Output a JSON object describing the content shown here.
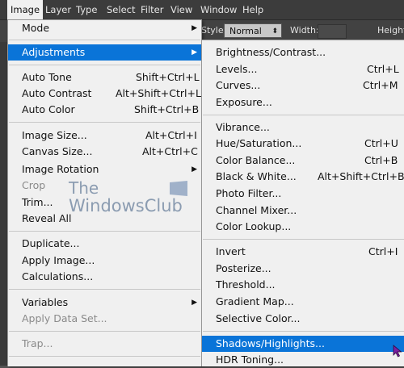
{
  "menubar": {
    "items": [
      "Image",
      "Layer",
      "Type",
      "Select",
      "Filter",
      "View",
      "Window",
      "Help"
    ]
  },
  "options_bar": {
    "style_label": "Style:",
    "style_value": "Normal",
    "width_label": "Width:",
    "height_label": "Height:"
  },
  "image_menu": {
    "items": [
      {
        "label": "Mode",
        "shortcut": "",
        "submenu": true
      },
      {
        "label": "Adjustments",
        "shortcut": "",
        "submenu": true,
        "highlighted": true
      },
      {
        "label": "Auto Tone",
        "shortcut": "Shift+Ctrl+L"
      },
      {
        "label": "Auto Contrast",
        "shortcut": "Alt+Shift+Ctrl+L"
      },
      {
        "label": "Auto Color",
        "shortcut": "Shift+Ctrl+B"
      },
      {
        "label": "Image Size...",
        "shortcut": "Alt+Ctrl+I"
      },
      {
        "label": "Canvas Size...",
        "shortcut": "Alt+Ctrl+C"
      },
      {
        "label": "Image Rotation",
        "shortcut": "",
        "submenu": true
      },
      {
        "label": "Crop",
        "shortcut": "",
        "disabled": true
      },
      {
        "label": "Trim...",
        "shortcut": ""
      },
      {
        "label": "Reveal All",
        "shortcut": ""
      },
      {
        "label": "Duplicate...",
        "shortcut": ""
      },
      {
        "label": "Apply Image...",
        "shortcut": ""
      },
      {
        "label": "Calculations...",
        "shortcut": ""
      },
      {
        "label": "Variables",
        "shortcut": "",
        "submenu": true
      },
      {
        "label": "Apply Data Set...",
        "shortcut": "",
        "disabled": true
      },
      {
        "label": "Trap...",
        "shortcut": "",
        "disabled": true
      }
    ]
  },
  "adjustments_menu": {
    "items": [
      {
        "label": "Brightness/Contrast...",
        "shortcut": ""
      },
      {
        "label": "Levels...",
        "shortcut": "Ctrl+L"
      },
      {
        "label": "Curves...",
        "shortcut": "Ctrl+M"
      },
      {
        "label": "Exposure...",
        "shortcut": ""
      },
      {
        "label": "Vibrance...",
        "shortcut": ""
      },
      {
        "label": "Hue/Saturation...",
        "shortcut": "Ctrl+U"
      },
      {
        "label": "Color Balance...",
        "shortcut": "Ctrl+B"
      },
      {
        "label": "Black & White...",
        "shortcut": "Alt+Shift+Ctrl+B"
      },
      {
        "label": "Photo Filter...",
        "shortcut": ""
      },
      {
        "label": "Channel Mixer...",
        "shortcut": ""
      },
      {
        "label": "Color Lookup...",
        "shortcut": ""
      },
      {
        "label": "Invert",
        "shortcut": "Ctrl+I"
      },
      {
        "label": "Posterize...",
        "shortcut": ""
      },
      {
        "label": "Threshold...",
        "shortcut": ""
      },
      {
        "label": "Gradient Map...",
        "shortcut": ""
      },
      {
        "label": "Selective Color...",
        "shortcut": ""
      },
      {
        "label": "Shadows/Highlights...",
        "shortcut": "",
        "highlighted": true
      },
      {
        "label": "HDR Toning...",
        "shortcut": ""
      }
    ]
  },
  "watermark": {
    "line1": "The",
    "line2": "WindowsClub"
  },
  "colors": {
    "highlight": "#0a74d8",
    "menu_bg": "#f0f0f0",
    "menubar_bg": "#3c3c3c",
    "disabled_text": "#8a8a8a"
  }
}
